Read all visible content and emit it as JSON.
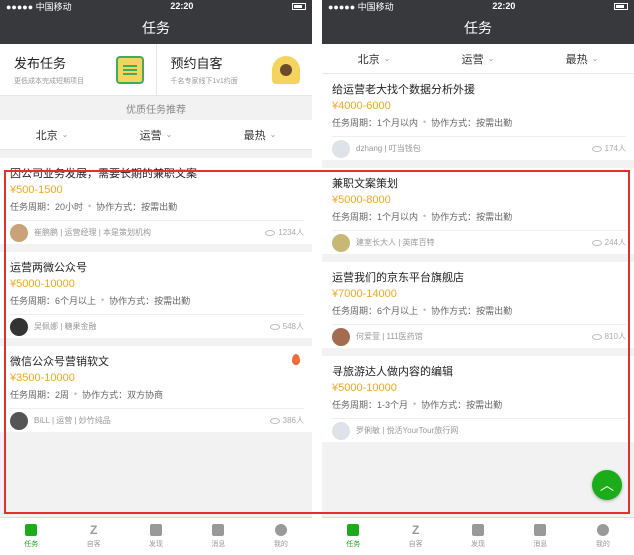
{
  "status": {
    "carrier": "●●●●● 中国移动",
    "time": "22:20"
  },
  "nav_title": "任务",
  "quick": {
    "publish_title": "发布任务",
    "publish_sub": "更低成本完成短期项目",
    "book_title": "预约自客",
    "book_sub": "千名专家线下1v1约面"
  },
  "section_title": "优质任务推荐",
  "filters": {
    "city": "北京",
    "category": "运营",
    "sort": "最热"
  },
  "left_cards": [
    {
      "title": "因公司业务发展，需要长期的兼职文案",
      "salary": "¥500-1500",
      "period": "任务周期：20小时",
      "mode": "协作方式：按需出勤",
      "poster": "崔鹏鹏 | 运营经理 | 本是策划机构",
      "views": "1234人"
    },
    {
      "title": "运营两微公众号",
      "salary": "¥5000-10000",
      "period": "任务周期：6个月以上",
      "mode": "协作方式：按需出勤",
      "poster": "吴佩娜 | 糖果金融",
      "views": "548人"
    },
    {
      "title": "微信公众号营销软文",
      "salary": "¥3500-10000",
      "period": "任务周期：2周",
      "mode": "协作方式：双方协商",
      "poster": "BiLL | 运营 | 妙竹纯品",
      "views": "386人"
    }
  ],
  "right_cards": [
    {
      "title": "给运营老大找个数据分析外援",
      "salary": "¥4000-6000",
      "period": "任务周期：1个月以内",
      "mode": "协作方式：按需出勤",
      "poster": "dzhang | 叮当钱包",
      "views": "174人"
    },
    {
      "title": "兼职文案策划",
      "salary": "¥5000-8000",
      "period": "任务周期：1个月以内",
      "mode": "协作方式：按需出勤",
      "poster": "建室长大人 | 英库百特",
      "views": "244人"
    },
    {
      "title": "运营我们的京东平台旗舰店",
      "salary": "¥7000-14000",
      "period": "任务周期：6个月以上",
      "mode": "协作方式：按需出勤",
      "poster": "何爱萱 | 111医药馆",
      "views": "810人"
    },
    {
      "title": "寻旅游达人做内容的编辑",
      "salary": "¥5000-10000",
      "period": "任务周期：1-3个月",
      "mode": "协作方式：按需出勤",
      "poster": "罗俐敏 | 悦活YourTour旅行网",
      "views": ""
    }
  ],
  "tabs": [
    "任务",
    "自客",
    "发现",
    "消息",
    "我的"
  ],
  "colors": {
    "accent": "#1aad19",
    "salary": "#f5a623",
    "highlight": "#e0312f",
    "navbar": "#38393d"
  },
  "icons": {
    "fab": "up-chevron-icon",
    "views": "eye-icon",
    "hot": "fire-icon"
  }
}
